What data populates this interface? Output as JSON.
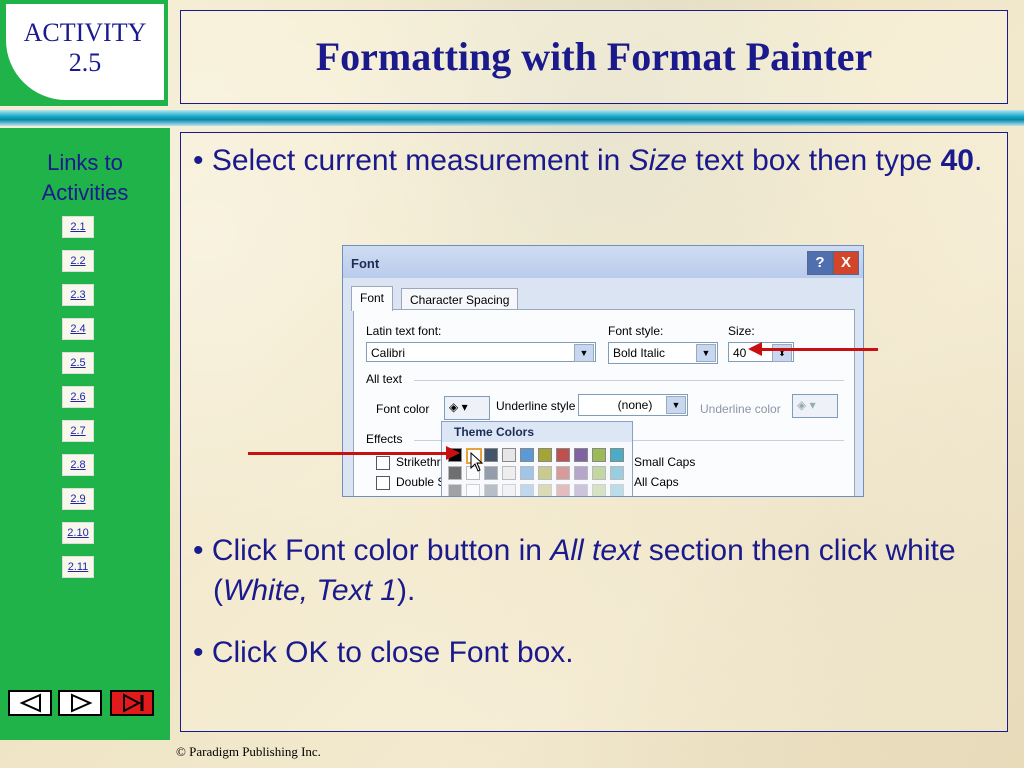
{
  "header": {
    "activity_label": "ACTIVITY",
    "activity_number": "2.5",
    "title": "Formatting with Format Painter"
  },
  "sidebar": {
    "title_line1": "Links to",
    "title_line2": "Activities",
    "links": [
      "2.1",
      "2.2",
      "2.3",
      "2.4",
      "2.5",
      "2.6",
      "2.7",
      "2.8",
      "2.9",
      "2.10",
      "2.11"
    ],
    "nav_buttons": [
      "back-button",
      "forward-button",
      "end-button"
    ]
  },
  "content": {
    "bullet1_a": "Select current measurement in ",
    "bullet1_italic": "Size",
    "bullet1_b": " text box then type ",
    "bullet1_bold": "40",
    "bullet1_c": ".",
    "bullet2_a": "Click Font color button in ",
    "bullet2_italic": "All text",
    "bullet2_b": " section then click white (",
    "bullet2_italic2": "White, Text 1",
    "bullet2_c": ").",
    "bullet3": "Click OK to close Font box."
  },
  "dialog": {
    "title": "Font",
    "help_label": "?",
    "close_label": "X",
    "tabs": [
      "Font",
      "Character Spacing"
    ],
    "latin_font_label": "Latin text font:",
    "latin_font_value": "Calibri",
    "font_style_label": "Font style:",
    "font_style_value": "Bold Italic",
    "size_label": "Size:",
    "size_value": "40",
    "all_text_label": "All text",
    "font_color_label": "Font color",
    "underline_style_label": "Underline style",
    "underline_style_value": "(none)",
    "underline_color_label": "Underline color",
    "effects_label": "Effects",
    "effect1": "Strikethr",
    "effect2": "Double S",
    "small_caps_label": "Small Caps",
    "all_caps_label": "All Caps",
    "palette_title": "Theme Colors",
    "theme_colors": [
      "#000000",
      "#ffffff",
      "#44546a",
      "#e7e6e6",
      "#5b9bd5",
      "#a5a535",
      "#c0504d",
      "#8064a2",
      "#9bbb59",
      "#4bacc6"
    ]
  },
  "footer": {
    "copyright": "© Paradigm Publishing Inc."
  },
  "colors": {
    "accent_green": "#1fb34a",
    "text_navy": "#1a1a8c",
    "arrow_red": "#c81010"
  }
}
